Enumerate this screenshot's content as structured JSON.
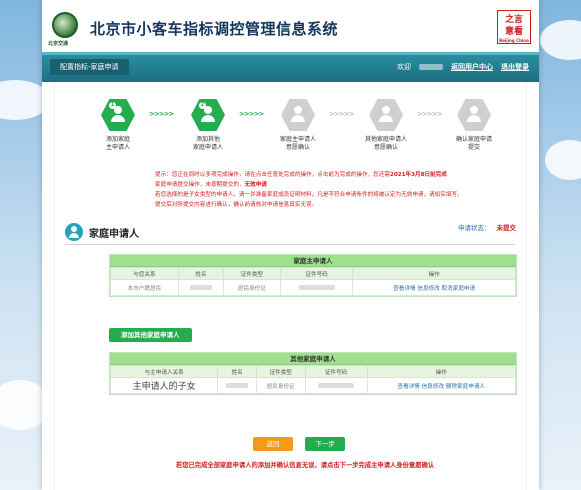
{
  "header": {
    "title": "北京市小客车指标调控管理信息系统",
    "logo_text": "北京交通",
    "brand_chars": "之言",
    "brand_chars2": "意看",
    "brand_sub": "Beijing China"
  },
  "nav": {
    "active_tab": "配置指标-家庭申请",
    "links": [
      "欢迎",
      "返回用户中心",
      "退出登录"
    ]
  },
  "steps": [
    {
      "num": "1",
      "label": "添加家庭\n主申请人",
      "state": "done",
      "icon": "user-icon"
    },
    {
      "num": "2",
      "label": "添加其他\n家庭申请人",
      "state": "done",
      "icon": "users-icon"
    },
    {
      "num": "3",
      "label": "家庭主申请人\n意愿确认",
      "state": "todo",
      "icon": "user-icon"
    },
    {
      "num": "4",
      "label": "其他家庭申请人\n意愿确认",
      "state": "todo",
      "icon": "users-icon"
    },
    {
      "num": "5",
      "label": "确认家庭申请\n提交",
      "state": "todo",
      "icon": "check-icon"
    }
  ],
  "arrows": ">>>>>",
  "notice": {
    "line1a": "提示：您正在同时以多项完成操作，请在点击任意处完成的操作，点击前为完成的操作，您还需",
    "line1b": "2021年3月8日前完成",
    "line2a": "家庭申请提交操作，未按期提交的，",
    "line2b": "无效申请",
    "line3": "若您选择的是子女类型的申请人，请一并准备家庭成员证明材料，凡是不符合申请条件的将被认定为无效申请，请如实填写。",
    "line4": "提交后对所提交内容进行确认，确认前请核对申请信息真实无误。"
  },
  "section": {
    "title": "家庭申请人",
    "status_label": "申请状态：",
    "status_value": "未提交"
  },
  "main_table": {
    "caption": "家庭主申请人",
    "headers": [
      "与您关系",
      "姓名",
      "证件类型",
      "证件号码",
      "操作"
    ],
    "row": {
      "relation": "本市户籍居民",
      "id_type": "居民身份证",
      "actions": [
        "查看详情",
        "信息修改",
        "取消家庭申请"
      ]
    }
  },
  "add_button": "添加其他家庭申请人",
  "other_table": {
    "caption": "其他家庭申请人",
    "headers": [
      "与主申请人关系",
      "姓名",
      "证件类型",
      "证件号码",
      "操作"
    ],
    "row": {
      "relation": "主申请人的子女",
      "id_type": "居民身份证",
      "actions": [
        "查看详情",
        "信息修改",
        "删除家庭申请人"
      ]
    }
  },
  "buttons": {
    "prev": "返回",
    "next": "下一步"
  },
  "footnote": "若您已完成全部家庭申请人的添加并确认信息无误，请点击下一步完成主申请人身份意愿确认",
  "colors": {
    "accent_green": "#23ad4e",
    "nav_teal": "#1c6f80",
    "warning_red": "#d52020",
    "link_blue": "#2b6fb0",
    "button_orange": "#f39c1a"
  }
}
